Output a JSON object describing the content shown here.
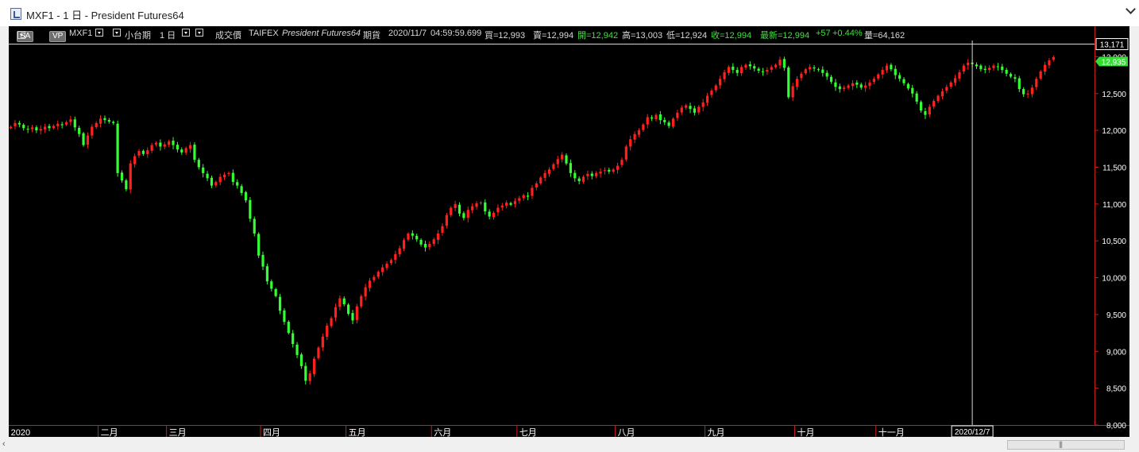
{
  "window": {
    "title": "MXF1 - 1 日 - President Futures64"
  },
  "toolbar": {
    "sa_label": "SA",
    "vp_label": "VP",
    "symbol": "MXF1",
    "product": "小台期",
    "period": "1 日",
    "price_type": "成交價",
    "exchange": "TAIFEX",
    "broker": "President Futures64",
    "category": "期貨",
    "date": "2020/11/7",
    "time": "04:59:59.699",
    "bid": "買=12,993",
    "ask": "賣=12,994",
    "open": "開=12,942",
    "high": "高=13,003",
    "low": "低=12,924",
    "close": "收=12,994",
    "last": "最新=12,994",
    "change": "+57",
    "change_pct": "+0.44%",
    "volume": "量=64,162"
  },
  "chart_data": {
    "type": "candlestick",
    "up_color": "#ff2020",
    "down_color": "#33ff33",
    "yticks": [
      8000,
      8500,
      9000,
      9500,
      10000,
      10500,
      11000,
      11500,
      12000,
      12500,
      13000
    ],
    "ytick_labels": [
      "8,000",
      "8,500",
      "9,000",
      "9,500",
      "10,000",
      "10,500",
      "11,000",
      "11,500",
      "12,000",
      "12,500",
      "13,000"
    ],
    "ylim": [
      8000,
      13220
    ],
    "months": [
      {
        "label": "2020",
        "start": 0
      },
      {
        "label": "二月",
        "start": 21
      },
      {
        "label": "三月",
        "start": 37
      },
      {
        "label": "四月",
        "start": 59
      },
      {
        "label": "五月",
        "start": 79
      },
      {
        "label": "六月",
        "start": 99
      },
      {
        "label": "七月",
        "start": 119
      },
      {
        "label": "八月",
        "start": 142
      },
      {
        "label": "九月",
        "start": 163
      },
      {
        "label": "十月",
        "start": 184
      },
      {
        "label": "十一月",
        "start": 203
      }
    ],
    "crosshair": {
      "price_label": "13,171",
      "date_label": "2020/12/7",
      "price": 13171,
      "index": 225
    },
    "last_price_label": "12,935",
    "last_price": 12935,
    "closes": [
      12050,
      12100,
      12080,
      12030,
      12010,
      12040,
      12000,
      12020,
      12050,
      12030,
      12060,
      12090,
      12070,
      12110,
      12150,
      12040,
      11950,
      11800,
      11930,
      12050,
      12100,
      12160,
      12140,
      12120,
      12100,
      11420,
      11320,
      11200,
      11550,
      11650,
      11720,
      11680,
      11730,
      11800,
      11830,
      11780,
      11810,
      11850,
      11800,
      11740,
      11700,
      11760,
      11800,
      11600,
      11500,
      11420,
      11350,
      11250,
      11300,
      11370,
      11400,
      11420,
      11300,
      11250,
      11150,
      11050,
      10800,
      10600,
      10300,
      10150,
      9950,
      9850,
      9750,
      9550,
      9400,
      9250,
      9100,
      8950,
      8800,
      8600,
      8700,
      8900,
      9050,
      9200,
      9350,
      9450,
      9600,
      9720,
      9640,
      9510,
      9420,
      9610,
      9750,
      9870,
      9960,
      10010,
      10080,
      10140,
      10190,
      10240,
      10320,
      10400,
      10510,
      10600,
      10570,
      10520,
      10450,
      10410,
      10460,
      10520,
      10600,
      10700,
      10850,
      10950,
      11000,
      10870,
      10810,
      10920,
      10970,
      11010,
      11020,
      10900,
      10830,
      10880,
      10950,
      10980,
      11020,
      10990,
      11040,
      11080,
      11120,
      11100,
      11220,
      11280,
      11360,
      11420,
      11470,
      11540,
      11610,
      11670,
      11550,
      11420,
      11350,
      11310,
      11370,
      11410,
      11380,
      11420,
      11440,
      11460,
      11440,
      11470,
      11520,
      11600,
      11780,
      11880,
      11950,
      12000,
      12080,
      12180,
      12160,
      12210,
      12140,
      12110,
      12060,
      12160,
      12240,
      12310,
      12340,
      12290,
      12240,
      12320,
      12380,
      12470,
      12540,
      12610,
      12700,
      12790,
      12860,
      12820,
      12780,
      12860,
      12890,
      12870,
      12840,
      12810,
      12790,
      12820,
      12860,
      12890,
      12960,
      12850,
      12450,
      12600,
      12700,
      12770,
      12830,
      12860,
      12840,
      12820,
      12780,
      12730,
      12660,
      12590,
      12560,
      12580,
      12610,
      12640,
      12620,
      12580,
      12610,
      12650,
      12700,
      12760,
      12820,
      12880,
      12830,
      12750,
      12700,
      12640,
      12570,
      12500,
      12390,
      12270,
      12210,
      12320,
      12400,
      12470,
      12530,
      12590,
      12650,
      12710,
      12790,
      12880,
      12920,
      12900,
      12870,
      12830,
      12820,
      12850,
      12880,
      12860,
      12820,
      12770,
      12730,
      12700,
      12560,
      12490,
      12500,
      12580,
      12700,
      12800,
      12890,
      12950,
      12994
    ]
  }
}
